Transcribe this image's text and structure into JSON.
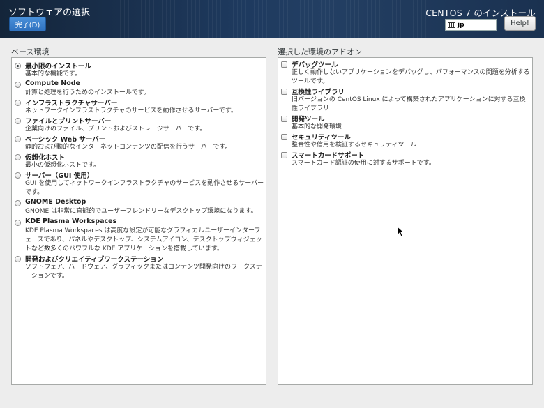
{
  "header": {
    "title": "ソフトウェアの選択",
    "done_label": "完了(D)",
    "installer_title": "CENTOS 7 のインストール",
    "keyboard_layout": "jp",
    "help_label": "Help!"
  },
  "base_environment": {
    "label": "ベース環境",
    "selected_index": 0,
    "items": [
      {
        "title": "最小限のインストール",
        "desc": "基本的な機能です。"
      },
      {
        "title": "Compute Node",
        "desc": "計算と処理を行うためのインストールです。"
      },
      {
        "title": "インフラストラクチャサーバー",
        "desc": "ネットワークインフラストラクチャのサービスを動作させるサーバーです。"
      },
      {
        "title": "ファイルとプリントサーバー",
        "desc": "企業向けのファイル、プリントおよびストレージサーバーです。"
      },
      {
        "title": "ベーシック Web サーバー",
        "desc": "静的および動的なインターネットコンテンツの配信を行うサーバーです。"
      },
      {
        "title": "仮想化ホスト",
        "desc": "最小の仮想化ホストです。"
      },
      {
        "title": "サーバー（GUI 使用）",
        "desc": "GUI を使用してネットワークインフラストラクチャのサービスを動作させるサーバーです。"
      },
      {
        "title": "GNOME Desktop",
        "desc": "GNOME は非常に直観的でユーザーフレンドリーなデスクトップ環境になります。"
      },
      {
        "title": "KDE Plasma Workspaces",
        "desc": "KDE Plasma Workspaces は高度な設定が可能なグラフィカルユーザーインターフェースであり、パネルやデスクトップ、システムアイコン、デスクトップウィジェットなど数多くのパワフルな KDE アプリケーションを搭載しています。"
      },
      {
        "title": "開発およびクリエイティブワークステーション",
        "desc": "ソフトウェア、ハードウェア、グラフィックまたはコンテンツ開発向けのワークステーションです。"
      }
    ]
  },
  "addons": {
    "label": "選択した環境のアドオン",
    "items": [
      {
        "title": "デバッグツール",
        "desc": "正しく動作しないアプリケーションをデバッグし、パフォーマンスの問題を分析するツールです。",
        "checked": false
      },
      {
        "title": "互換性ライブラリ",
        "desc": "旧バージョンの CentOS Linux によって構築されたアプリケーションに対する互換性ライブラリ",
        "checked": false
      },
      {
        "title": "開発ツール",
        "desc": "基本的な開発環境",
        "checked": false
      },
      {
        "title": "セキュリティツール",
        "desc": "整合性や信用を検証するセキュリティツール",
        "checked": false
      },
      {
        "title": "スマートカードサポート",
        "desc": "スマートカード認証の使用に対するサポートです。",
        "checked": false
      }
    ]
  }
}
